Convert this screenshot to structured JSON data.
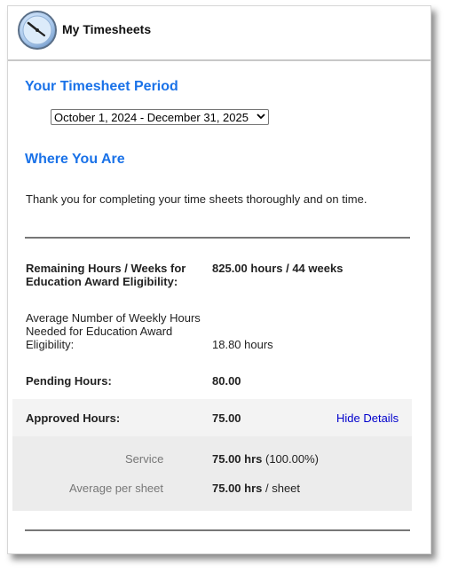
{
  "header": {
    "title": "My Timesheets",
    "icon": "clock-icon"
  },
  "period": {
    "heading": "Your Timesheet Period",
    "selected": "October 1, 2024 - December 31, 2025"
  },
  "status": {
    "heading": "Where You Are",
    "message": "Thank you for completing your time sheets thoroughly and on time."
  },
  "stats": {
    "remaining_label_1": "Remaining Hours / Weeks for",
    "remaining_label_2": "Education Award Eligibility:",
    "remaining_value": "825.00 hours / 44 weeks",
    "avg_label_1": "Average Number of Weekly Hours",
    "avg_label_2": "Needed for Education Award",
    "avg_label_3": "Eligibility:",
    "avg_value": "18.80 hours",
    "pending_label": "Pending Hours:",
    "pending_value": "80.00",
    "approved_label": "Approved Hours:",
    "approved_value": "75.00",
    "toggle_link": "Hide Details"
  },
  "details": {
    "service_label": "Service",
    "service_value": "75.00 hrs",
    "service_pct": "(100.00%)",
    "avg_label": "Average per sheet",
    "avg_value": "75.00 hrs",
    "avg_unit": "/ sheet"
  },
  "colors": {
    "heading": "#1a72e8",
    "link": "#0000cc",
    "band_approved": "#f3f3f3",
    "band_details": "#ececec"
  }
}
